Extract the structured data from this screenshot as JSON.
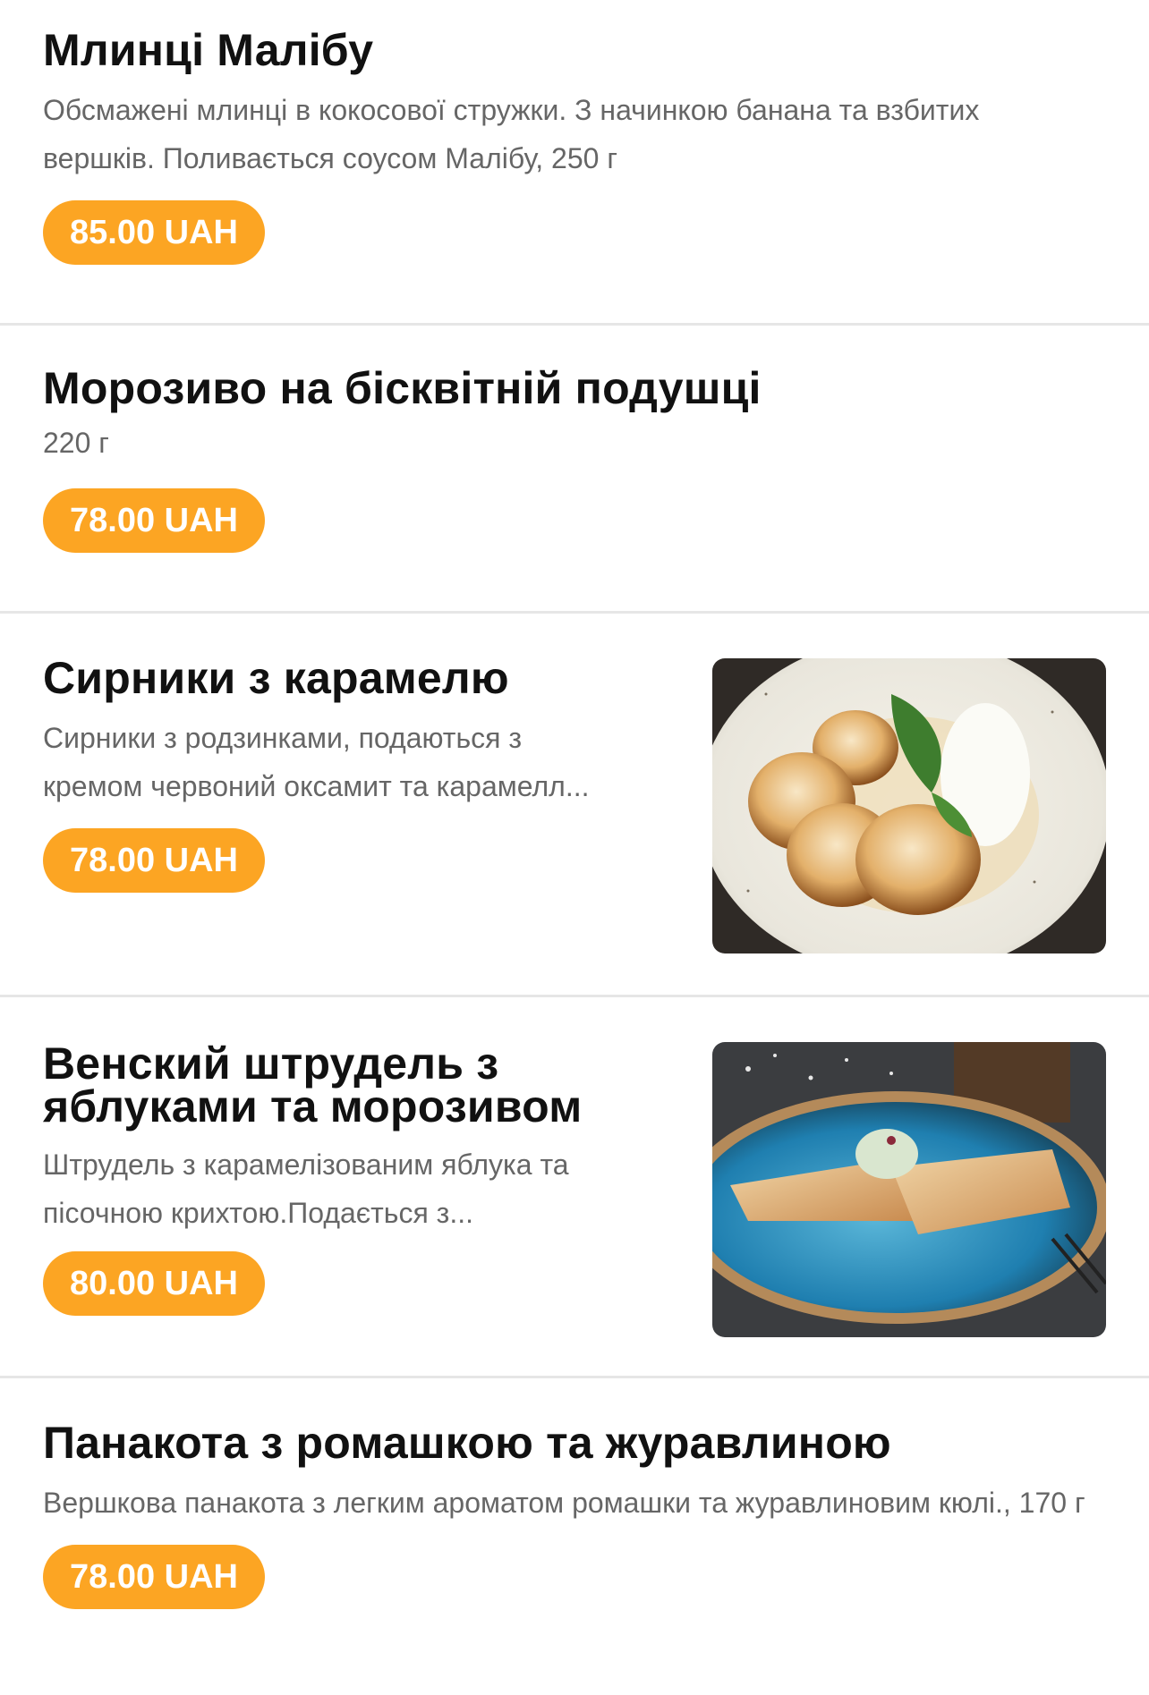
{
  "menu": {
    "items": [
      {
        "title": "Млинці Малібу",
        "description": "Обсмажені млинці в кокосової стружки. З начинкою банана та взбитих вершків. Поливається соусом Малібу, 250 г",
        "price": "85.00 UAH"
      },
      {
        "title": "Морозиво на бісквітній подушці",
        "description": "220 г",
        "price": "78.00 UAH"
      },
      {
        "title": "Сирники з карамелю",
        "description_lines": [
          "Сирники з родзинками, подаються з",
          "кремом червоний оксамит та карамелл..."
        ],
        "price": "78.00 UAH",
        "image": "syrniki-photo"
      },
      {
        "title": "Венский штрудель з яблуками та морозивом",
        "description_lines": [
          "Штрудель з карамелізованим яблука та",
          "пісочною крихтою.Подається з..."
        ],
        "price": "80.00 UAH",
        "image": "strudel-photo"
      },
      {
        "title": "Панакота з ромашкою та журавлиною",
        "description": "Вершкова панакота з легким ароматом ромашки та журавлиновим кюлі., 170 г",
        "price": "78.00 UAH"
      }
    ]
  },
  "colors": {
    "price_badge": "#fca523",
    "divider": "#e6e6e6",
    "title": "#111111",
    "description": "#666666"
  }
}
